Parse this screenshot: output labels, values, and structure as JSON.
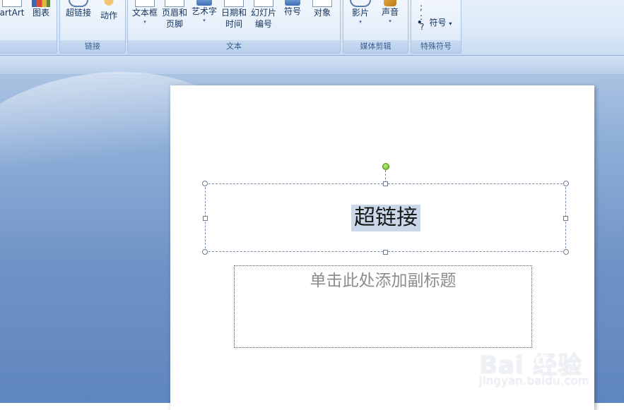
{
  "ribbon": {
    "groups": {
      "illustrations": {
        "smartart": "artArt",
        "chart": "图表"
      },
      "links": {
        "label": "链接",
        "hyperlink": "超链接",
        "action": "动作"
      },
      "text": {
        "label": "文本",
        "textbox": "文本框",
        "header_footer_1": "页眉和",
        "header_footer_2": "页脚",
        "wordart": "艺术字",
        "datetime_1": "日期和",
        "datetime_2": "时间",
        "slide_number_1": "幻灯片",
        "slide_number_2": "编号",
        "symbol": "符号",
        "object": "对象"
      },
      "media": {
        "label": "媒体剪辑",
        "movie": "影片",
        "sound": "声音"
      },
      "special_symbols": {
        "label": "特殊符号",
        "symbols_row": "; : ?",
        "bullet": "•",
        "symbol": "符号"
      }
    },
    "caret": "▾"
  },
  "slide": {
    "title": "超链接",
    "subtitle_placeholder": "单击此处添加副标题"
  },
  "watermark": {
    "logo": "Bai  经验",
    "logo_du": "du",
    "url": "jingyan.baidu.com"
  },
  "colors": {
    "accent_blue": "#15325c",
    "selection_highlight": "#c9d7e9",
    "rotate_handle": "#5fb824"
  }
}
